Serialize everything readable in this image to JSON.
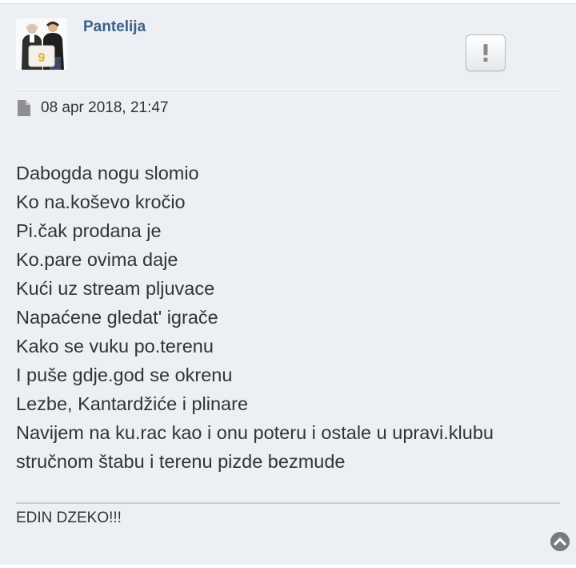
{
  "post": {
    "author": "Pantelija",
    "date": "08 apr 2018, 21:47",
    "report_glyph": "!",
    "avatar_badge_number": "9",
    "content_lines": [
      "Dabogda nogu slomio",
      "Ko na.koševo kročio",
      "Pi.čak prodana je",
      "Ko.pare ovima daje",
      "Kući uz stream pljuvace",
      "Napaćene gledat' igrače",
      "Kako se vuku po.terenu",
      "I puše gdje.god se okrenu",
      "Lezbe, Kantardžiće i plinare",
      "Navijem na ku.rac kao i onu poteru i ostale u upravi.klubu",
      "stručnom štabu i terenu pizde bezmude"
    ],
    "signature": "EDIN DZEKO!!!"
  },
  "icons": {
    "avatar": "avatar-photo",
    "report": "exclamation-icon",
    "post_meta": "file-icon",
    "back_to_top": "chevron-up-circle-icon"
  },
  "colors": {
    "background": "#eceff3",
    "author": "#3b6186",
    "text": "#333333",
    "icon": "#8f8f8f"
  }
}
